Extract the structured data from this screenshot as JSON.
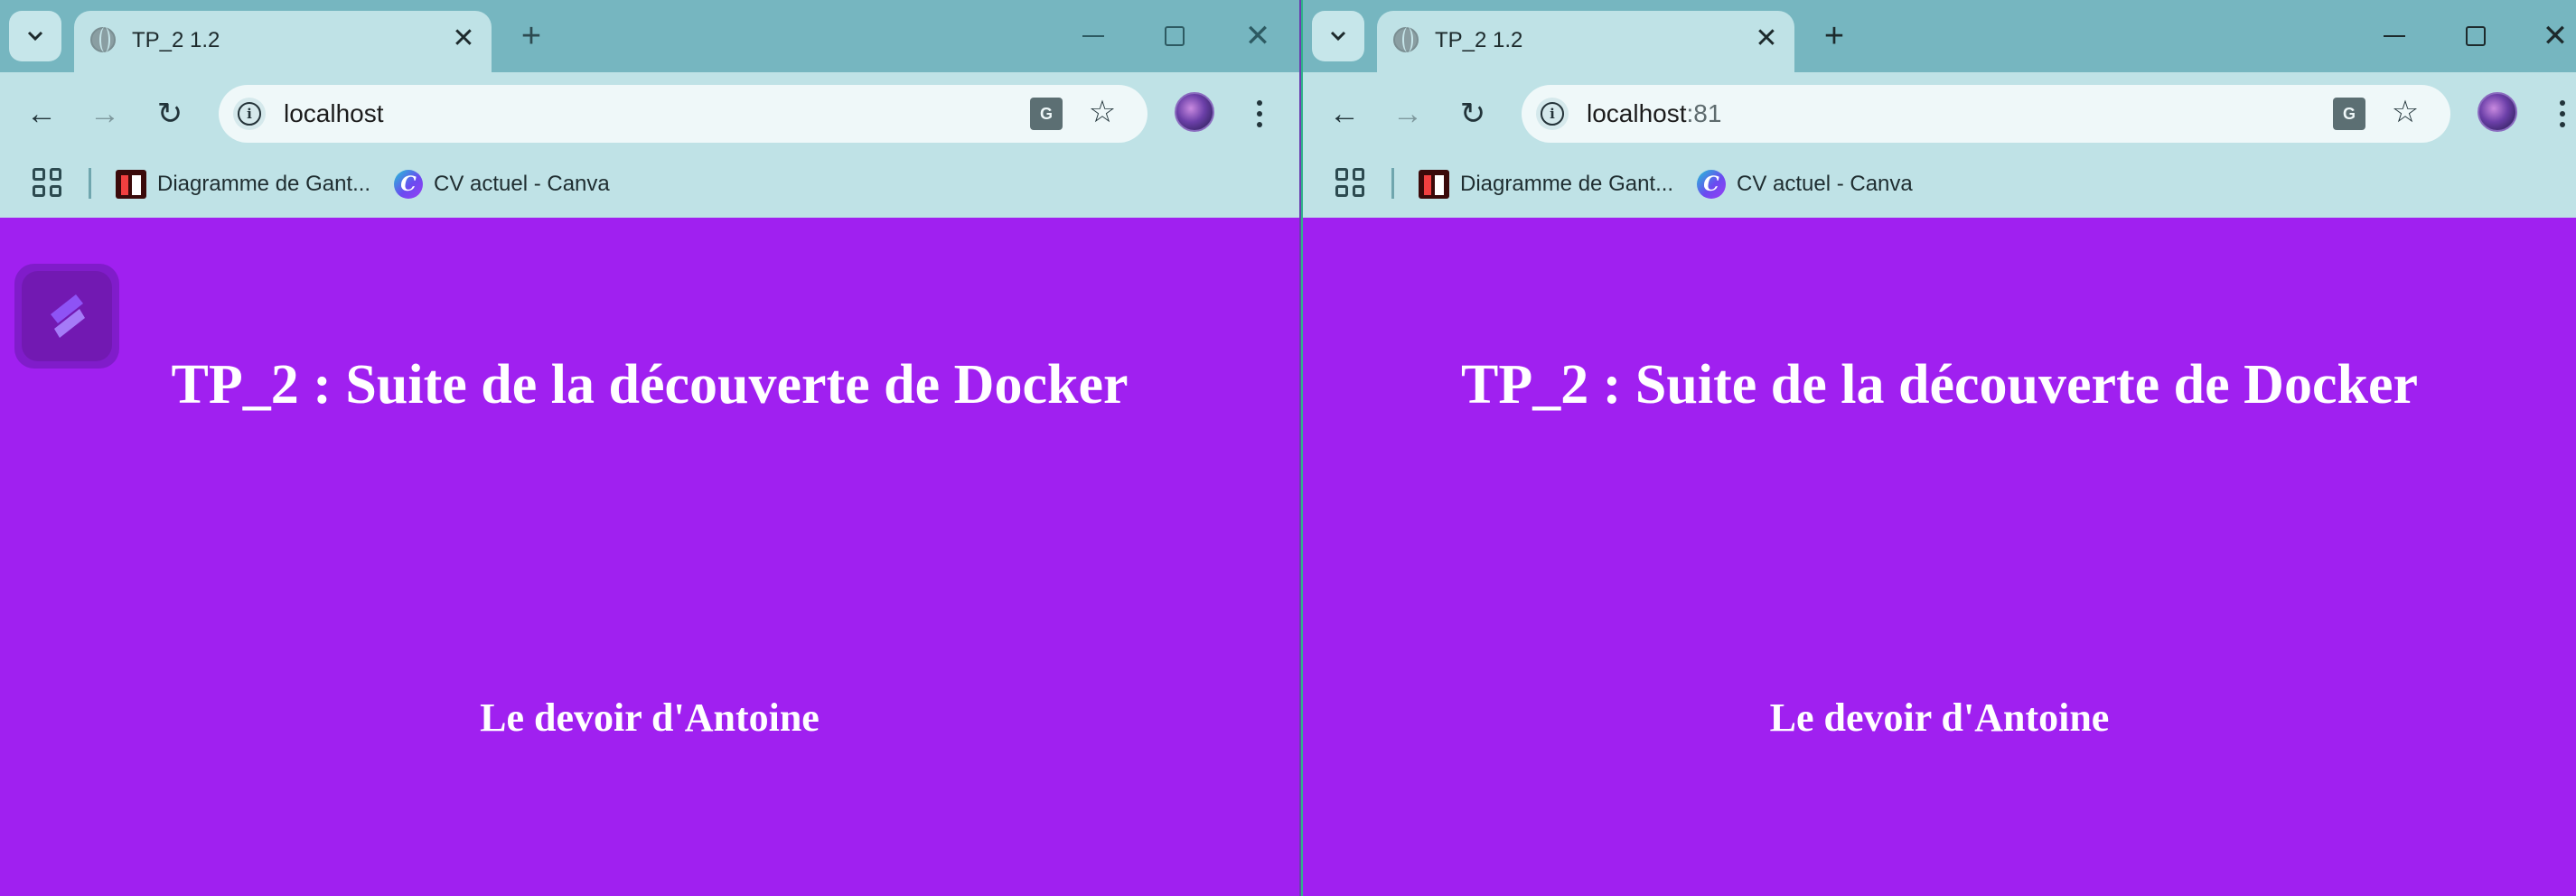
{
  "colors": {
    "page_background": "#a020f0",
    "tabstrip": "#76b6c0",
    "toolbar": "#bfe2e6",
    "text": "#ffffff"
  },
  "left_window": {
    "tab": {
      "title": "TP_2 1.2",
      "close_glyph": "✕"
    },
    "new_tab_glyph": "+",
    "address": {
      "host": "localhost",
      "port": ""
    },
    "bookmarks": [
      {
        "label": "Diagramme de Gant...",
        "icon": "gantt-favicon"
      },
      {
        "label": "CV actuel - Canva",
        "icon": "canva-favicon"
      }
    ],
    "page": {
      "heading": "TP_2 : Suite de la découverte de Docker",
      "subheading": "Le devoir d'Antoine"
    }
  },
  "right_window": {
    "tab": {
      "title": "TP_2 1.2",
      "close_glyph": "✕"
    },
    "new_tab_glyph": "+",
    "address": {
      "host": "localhost",
      "port": ":81"
    },
    "bookmarks": [
      {
        "label": "Diagramme de Gant...",
        "icon": "gantt-favicon"
      },
      {
        "label": "CV actuel - Canva",
        "icon": "canva-favicon"
      }
    ],
    "page": {
      "heading": "TP_2 : Suite de la découverte de Docker",
      "subheading": "Le devoir d'Antoine"
    }
  },
  "glyphs": {
    "back": "←",
    "forward": "→",
    "reload": "↻",
    "star": "☆",
    "translate": "G",
    "chevron": "⌄",
    "close": "✕"
  }
}
